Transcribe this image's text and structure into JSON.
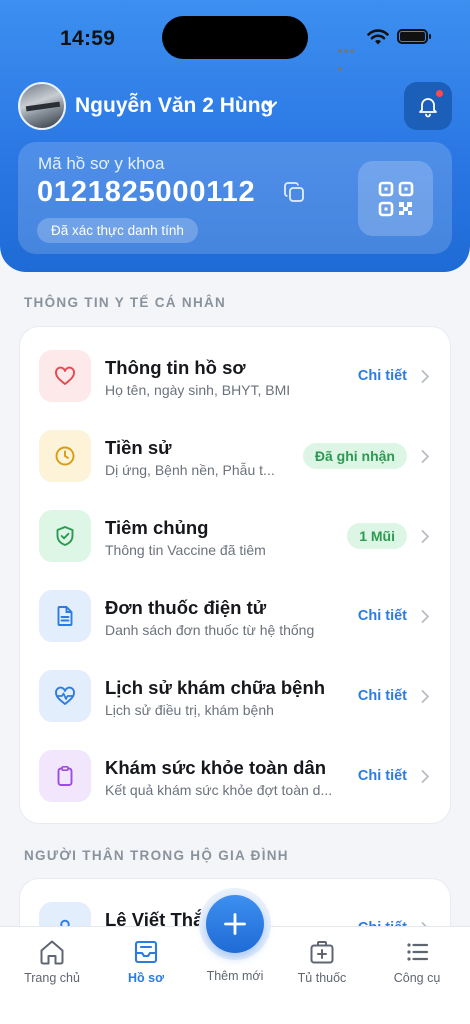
{
  "status_bar": {
    "time": "14:59"
  },
  "header": {
    "user_name": "Nguyễn Văn 2 Hùng",
    "record_label": "Mã hồ sơ y khoa",
    "record_number": "0121825000112",
    "verified_text": "Đã xác thực danh tính"
  },
  "sections": {
    "personal_title": "THÔNG TIN Y TẾ CÁ NHÂN",
    "family_title": "NGƯỜI THÂN TRONG HỘ GIA ĐÌNH"
  },
  "items": [
    {
      "title": "Thông tin hồ sơ",
      "subtitle": "Họ tên, ngày sinh, BHYT, BMI",
      "action": "Chi tiết",
      "icon": "heart-icon",
      "color": "#e5484d",
      "bg": "#fde8ea"
    },
    {
      "title": "Tiền sử",
      "subtitle": "Dị ứng, Bệnh nền, Phẫu t...",
      "action": "Đã ghi nhận",
      "icon": "clock-icon",
      "color": "#d99a14",
      "bg": "#fdf3d8"
    },
    {
      "title": "Tiêm chủng",
      "subtitle": "Thông tin Vaccine đã tiêm",
      "action": "1 Mũi",
      "icon": "shield-check-icon",
      "color": "#2c9a52",
      "bg": "#def6e6"
    },
    {
      "title": "Đơn thuốc điện tử",
      "subtitle": "Danh sách đơn thuốc từ hệ thống",
      "action": "Chi tiết",
      "icon": "document-icon",
      "color": "#2b7be0",
      "bg": "#e3eefd"
    },
    {
      "title": "Lịch sử khám chữa bệnh",
      "subtitle": "Lịch sử điều trị, khám bệnh",
      "action": "Chi tiết",
      "icon": "heartbeat-icon",
      "color": "#2b7be0",
      "bg": "#e3eefd"
    },
    {
      "title": "Khám sức khỏe toàn dân",
      "subtitle": "Kết quả khám sức khỏe đợt toàn d...",
      "action": "Chi tiết",
      "icon": "clipboard-icon",
      "color": "#9b4de0",
      "bg": "#f2e6fd"
    }
  ],
  "family": [
    {
      "name": "Lê Viết Thắng",
      "action": "Chi tiết"
    }
  ],
  "tabs": [
    {
      "label": "Trang chủ",
      "icon": "home-icon"
    },
    {
      "label": "Hồ sơ",
      "icon": "inbox-icon",
      "active": true
    },
    {
      "label": "Thêm mới",
      "icon": "plus-icon"
    },
    {
      "label": "Tủ thuốc",
      "icon": "medicine-cabinet-icon"
    },
    {
      "label": "Công cụ",
      "icon": "list-icon"
    }
  ]
}
